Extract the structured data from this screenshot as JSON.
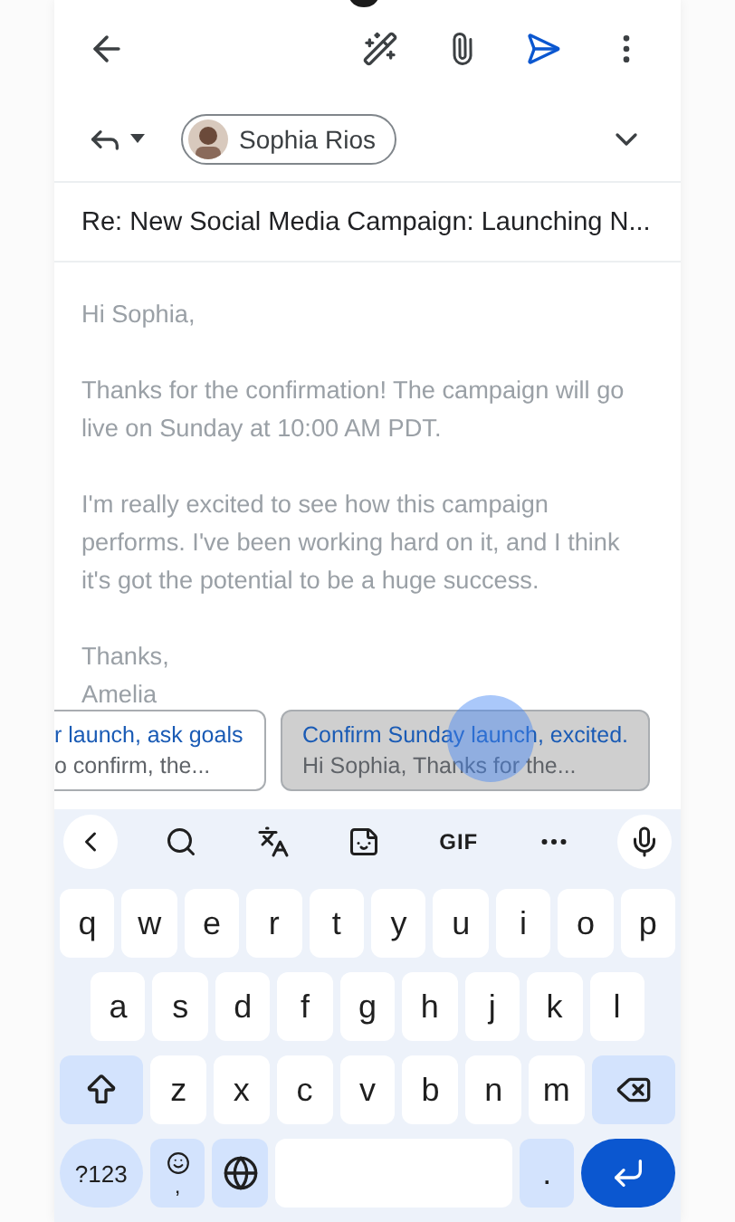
{
  "recipient": {
    "name": "Sophia Rios"
  },
  "subject": "Re: New Social Media Campaign: Launching N...",
  "body": [
    "Hi Sophia,",
    "Thanks for the confirmation! The campaign will go live on Sunday at 10:00 AM PDT.",
    "I'm really excited to see how this campaign performs. I've been working hard on it, and I think it's got the potential to be a huge success.",
    "Thanks,\nAmelia"
  ],
  "suggestions": [
    {
      "title": "r launch, ask goals",
      "preview": "o confirm, the...",
      "selected": false
    },
    {
      "title": "Confirm Sunday launch, excited.",
      "preview": "Hi Sophia, Thanks for the...",
      "selected": true
    }
  ],
  "keyboard": {
    "toolbar": {
      "gif": "GIF"
    },
    "rows": [
      [
        "q",
        "w",
        "e",
        "r",
        "t",
        "y",
        "u",
        "i",
        "o",
        "p"
      ],
      [
        "a",
        "s",
        "d",
        "f",
        "g",
        "h",
        "j",
        "k",
        "l"
      ],
      [
        "z",
        "x",
        "c",
        "v",
        "b",
        "n",
        "m"
      ]
    ],
    "symbols_key": "?123",
    "comma_key": ",",
    "period_key": "."
  }
}
